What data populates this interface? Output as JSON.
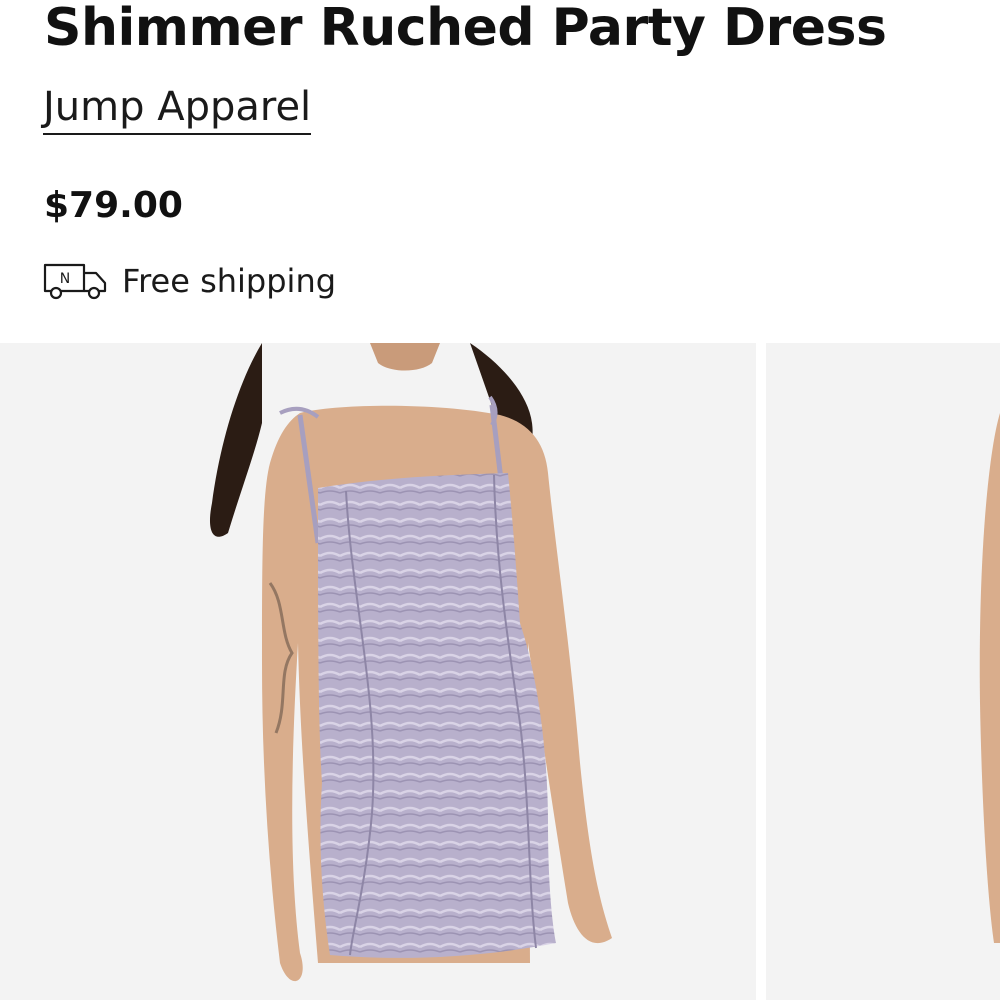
{
  "product": {
    "title": "Shimmer Ruched Party Dress",
    "brand": "Jump Apparel",
    "price": "$79.00",
    "shipping": {
      "label": "Free shipping",
      "icon": "delivery-truck-icon",
      "icon_badge": "N"
    }
  },
  "gallery": {
    "images": [
      {
        "name": "product-image-main",
        "subject": "lilac ruched dress front view"
      },
      {
        "name": "product-image-next",
        "subject": "second view partially visible"
      }
    ]
  },
  "colors": {
    "text": "#111111",
    "photo_background": "#f3f3f3",
    "dress": "#b8b0cc",
    "skin": "#d9ad8c",
    "hair": "#2b1c14"
  }
}
